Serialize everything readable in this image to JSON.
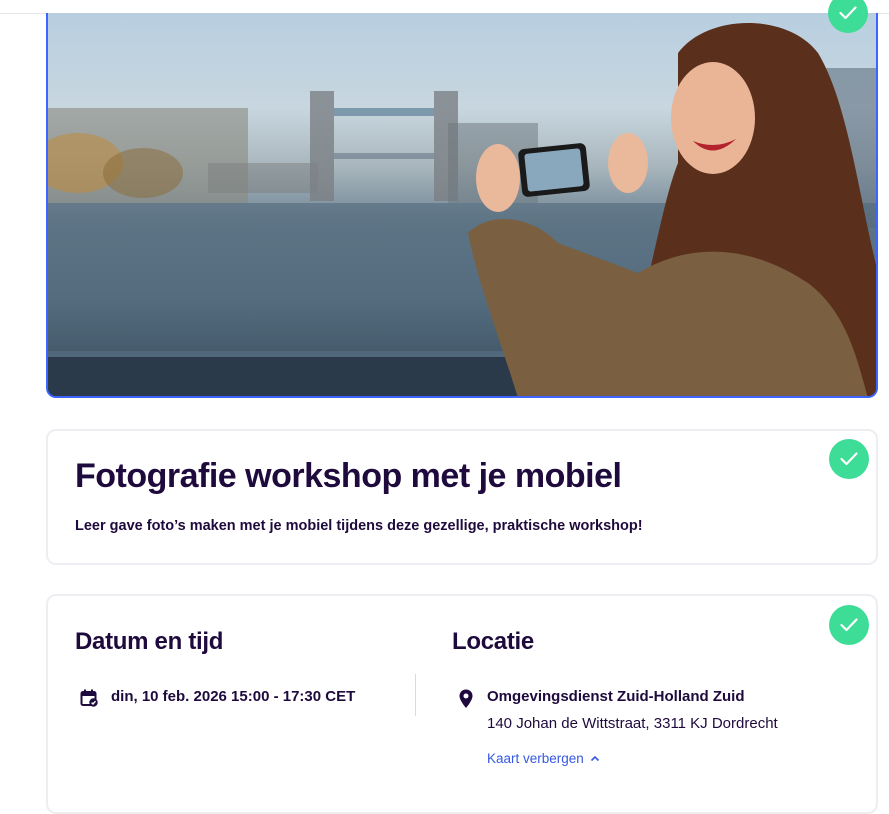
{
  "event": {
    "title": "Fotografie workshop met je mobiel",
    "summary": "Leer gave foto’s maken met je mobiel tijdens deze gezellige, praktische workshop!"
  },
  "datetime": {
    "heading": "Datum en tijd",
    "value": "din, 10 feb. 2026 15:00 - 17:30 CET"
  },
  "location": {
    "heading": "Locatie",
    "name": "Omgevingsdienst Zuid-Holland Zuid",
    "address": "140 Johan de Wittstraat, 3311 KJ Dordrecht",
    "map_toggle": "Kaart verbergen"
  },
  "colors": {
    "accent": "#3659e3",
    "check": "#3ddc97",
    "text": "#1e0a3c",
    "hero_border": "#3d64ff"
  },
  "icons": [
    "check-icon",
    "calendar-check-icon",
    "map-pin-icon",
    "chevron-up-icon"
  ]
}
